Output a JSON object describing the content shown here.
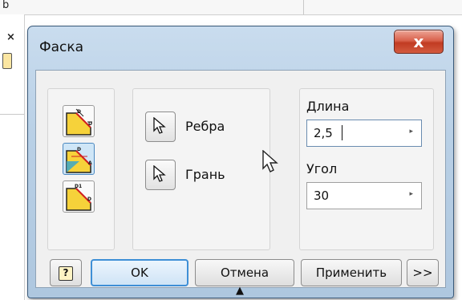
{
  "background": {
    "top_letter": "b",
    "left_close": "×"
  },
  "dialog": {
    "title": "Фаска",
    "close_label": "x",
    "selection": [
      {
        "label": "Ребра",
        "icon": "arrow-cursor-icon"
      },
      {
        "label": "Грань",
        "icon": "arrow-cursor-icon"
      }
    ],
    "length_label": "Длина",
    "length_value": "2,5",
    "angle_label": "Угол",
    "angle_value": "30",
    "field_arrow": "▸",
    "buttons": {
      "help": "?",
      "ok": "OK",
      "cancel": "Отмена",
      "apply": "Применить",
      "more": ">>"
    },
    "expander": "▲"
  },
  "colors": {
    "accent": "#3e8fd6",
    "close_red": "#c13b22",
    "dialog_frame": "#b9d0e6",
    "icon_yellow": "#f6d23a"
  }
}
